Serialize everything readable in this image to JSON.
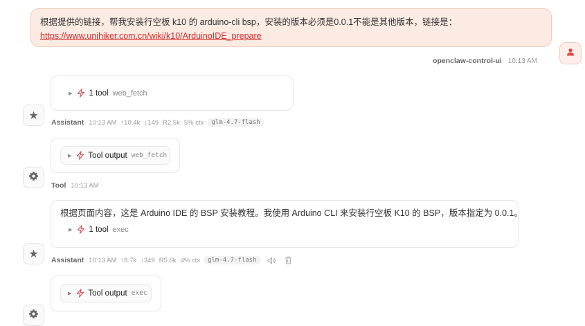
{
  "user_message": {
    "text": "根据提供的链接，帮我安装行空板 k10 的 arduino-cli bsp，安装的版本必须是0.0.1不能是其他版本，链接是：",
    "link": "https://www.unihiker.com.cn/wiki/k10/ArduinoIDE_prepare",
    "sender": "openclaw-control-ui",
    "time": "10:13 AM"
  },
  "messages": [
    {
      "tool_summary": {
        "label": "1 tool",
        "tool": "web_fetch"
      },
      "meta": {
        "who": "Assistant",
        "time": "10:13 AM",
        "in": "↑10.4k",
        "out": "↓149",
        "reads": "R2.5k",
        "ctx": "5% ctx",
        "model": "glm-4.7-flash"
      }
    },
    {
      "tool_output": {
        "label": "Tool output",
        "tool": "web_fetch"
      },
      "meta": {
        "who": "Tool",
        "time": "10:13 AM"
      }
    },
    {
      "text": "根据页面内容，这是 Arduino IDE 的 BSP 安装教程。我使用 Arduino CLI 来安装行空板 K10 的 BSP，版本指定为 0.0.1。",
      "tool_summary": {
        "label": "1 tool",
        "tool": "exec"
      },
      "meta": {
        "who": "Assistant",
        "time": "10:13 AM",
        "in": "↑8.7k",
        "out": "↓349",
        "reads": "R5.6k",
        "ctx": "4% ctx",
        "model": "glm-4.7-flash"
      }
    },
    {
      "tool_output": {
        "label": "Tool output",
        "tool": "exec"
      }
    }
  ],
  "icons": {
    "user_avatar": "user-icon",
    "assistant_avatar": "star-icon",
    "tool_avatar": "gear-icon",
    "tool_glyph": "lightning-icon",
    "speak": "speaker-icon",
    "delete": "trash-icon"
  },
  "colors": {
    "accent": "#e04848",
    "user_bubble_bg": "#fbebe3",
    "user_bubble_border": "#f0cdbd"
  }
}
